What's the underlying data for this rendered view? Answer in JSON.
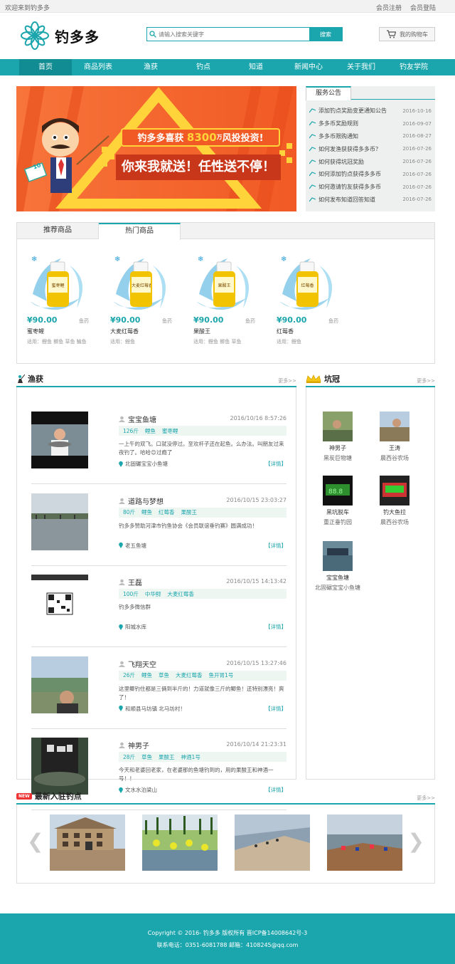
{
  "topbar": {
    "welcome": "欢迎来到钓多多",
    "register": "会员注册",
    "login": "会员登陆"
  },
  "header": {
    "logo_text": "钓多多",
    "search_placeholder": "请输入搜索关键字",
    "search_button": "搜索",
    "cart": "我的购物车"
  },
  "nav": [
    "首页",
    "商品列表",
    "渔获",
    "钓点",
    "知道",
    "新闻中心",
    "关于我们",
    "钓友学院"
  ],
  "banner": {
    "headline": "钓多多喜获",
    "amount": "8300",
    "unit": "万",
    "tail": "风投投资!",
    "slogan": "你来我就送！任性送不停！",
    "card": "10"
  },
  "notices": {
    "title": "服务公告",
    "items": [
      {
        "text": "添加钓点奖励变更通知公告",
        "date": "2016-10-16"
      },
      {
        "text": "多多币奖励规则",
        "date": "2016-09-07"
      },
      {
        "text": "多多币限购通知",
        "date": "2016-08-27"
      },
      {
        "text": "如何发渔获获得多多币？",
        "date": "2016-07-26"
      },
      {
        "text": "如何获得坑冠奖励",
        "date": "2016-07-26"
      },
      {
        "text": "如何添加钓点获得多多币",
        "date": "2016-07-26"
      },
      {
        "text": "如何邀请钓友获得多多币",
        "date": "2016-07-26"
      },
      {
        "text": "如何发布知道回答知道",
        "date": "2016-07-26"
      }
    ]
  },
  "products": {
    "tabs": [
      "推荐商品",
      "热门商品"
    ],
    "items": [
      {
        "label": "蜜枣鲤",
        "price": "¥90.00",
        "cat": "鱼药",
        "name": "蜜枣鲤",
        "use": "适用：鲤鱼  鲫鱼  草鱼  鳊鱼"
      },
      {
        "label": "大麦红莓香",
        "price": "¥90.00",
        "cat": "鱼药",
        "name": "大麦红莓香",
        "use": "适用：鲤鱼"
      },
      {
        "label": "果酸王",
        "price": "¥90.00",
        "cat": "鱼药",
        "name": "果酸王",
        "use": "适用：鲤鱼  鲫鱼  草鱼"
      },
      {
        "label": "红莓香",
        "price": "¥90.00",
        "cat": "鱼药",
        "name": "红莓香",
        "use": "适用：鲤鱼"
      }
    ]
  },
  "catch": {
    "title": "渔获",
    "more": "更多>>",
    "items": [
      {
        "user": "宝宝鱼塘",
        "time": "2016/10/16 8:57:26",
        "tags": [
          "126斤",
          "鲤鱼",
          "蜜枣鲤"
        ],
        "desc": "一上午的双飞。口就没停过。至欢杆子还在起鱼。么办法。叫朋友过来夜钓了。哈哈😊过瘾了",
        "loc": "北固碾宝宝小鱼塘",
        "detail": "【详情】"
      },
      {
        "user": "道路与梦想",
        "time": "2016/10/15 23:03:27",
        "tags": [
          "80斤",
          "鲤鱼",
          "红莓香",
          "果酸王"
        ],
        "desc": "钓多多赞助河津市钓鱼协会《会员联谊垂钓赛》圆满成功！",
        "loc": "老五鱼塘",
        "detail": "【详情】"
      },
      {
        "user": "王磊",
        "time": "2016/10/15 14:13:42",
        "tags": [
          "100斤",
          "中华鲟",
          "大麦红莓香"
        ],
        "desc": "钓多多微信群",
        "loc": "阳城水库",
        "detail": "【详情】"
      },
      {
        "user": "飞翔天空",
        "time": "2016/10/15 13:27:46",
        "tags": [
          "26斤",
          "鲤鱼",
          "草鱼",
          "大麦红莓香",
          "鱼开胃1号"
        ],
        "desc": "这里鲫钓住都是三俩到半斤的！力道就像三斤的鲫鱼！还特别漂亮！爽了！",
        "loc": "和顺县马坊镇 北马坊村！",
        "detail": "【详情】"
      },
      {
        "user": "神男子",
        "time": "2016/10/14 21:23:31",
        "tags": [
          "28斤",
          "草鱼",
          "果酸王",
          "神酒1号"
        ],
        "desc": "今天和老婆回老家，在老婆那的鱼塘钓到的，用的果酸王和神酒一号！！",
        "loc": "文水水泊梁山",
        "detail": "【详情】"
      }
    ]
  },
  "champs": {
    "title": "坑冠",
    "more": "更多>>",
    "items": [
      {
        "name": "神男子",
        "place": "黑炭巨物塘"
      },
      {
        "name": "王涛",
        "place": "晨西谷农场"
      },
      {
        "name": "黑坑脱车",
        "place": "重正垂钓园"
      },
      {
        "name": "钓大鱼拉",
        "place": "晨西谷农场"
      },
      {
        "name": "宝宝鱼塘",
        "place": "北固碾宝宝小鱼塘"
      }
    ]
  },
  "spots": {
    "title": "最新入驻钓点",
    "badge": "NEW",
    "more": "更多>>"
  },
  "footer": {
    "line1": "Copyright © 2016- 钓多多 版权所有 晋ICP备14008642号-3",
    "line2": "联系电话：0351-6081788     邮箱：4108245@qq.com"
  },
  "colors": {
    "primary": "#1ba5ac",
    "primary_dark": "#108c92",
    "banner_orange": "#f4682a"
  }
}
